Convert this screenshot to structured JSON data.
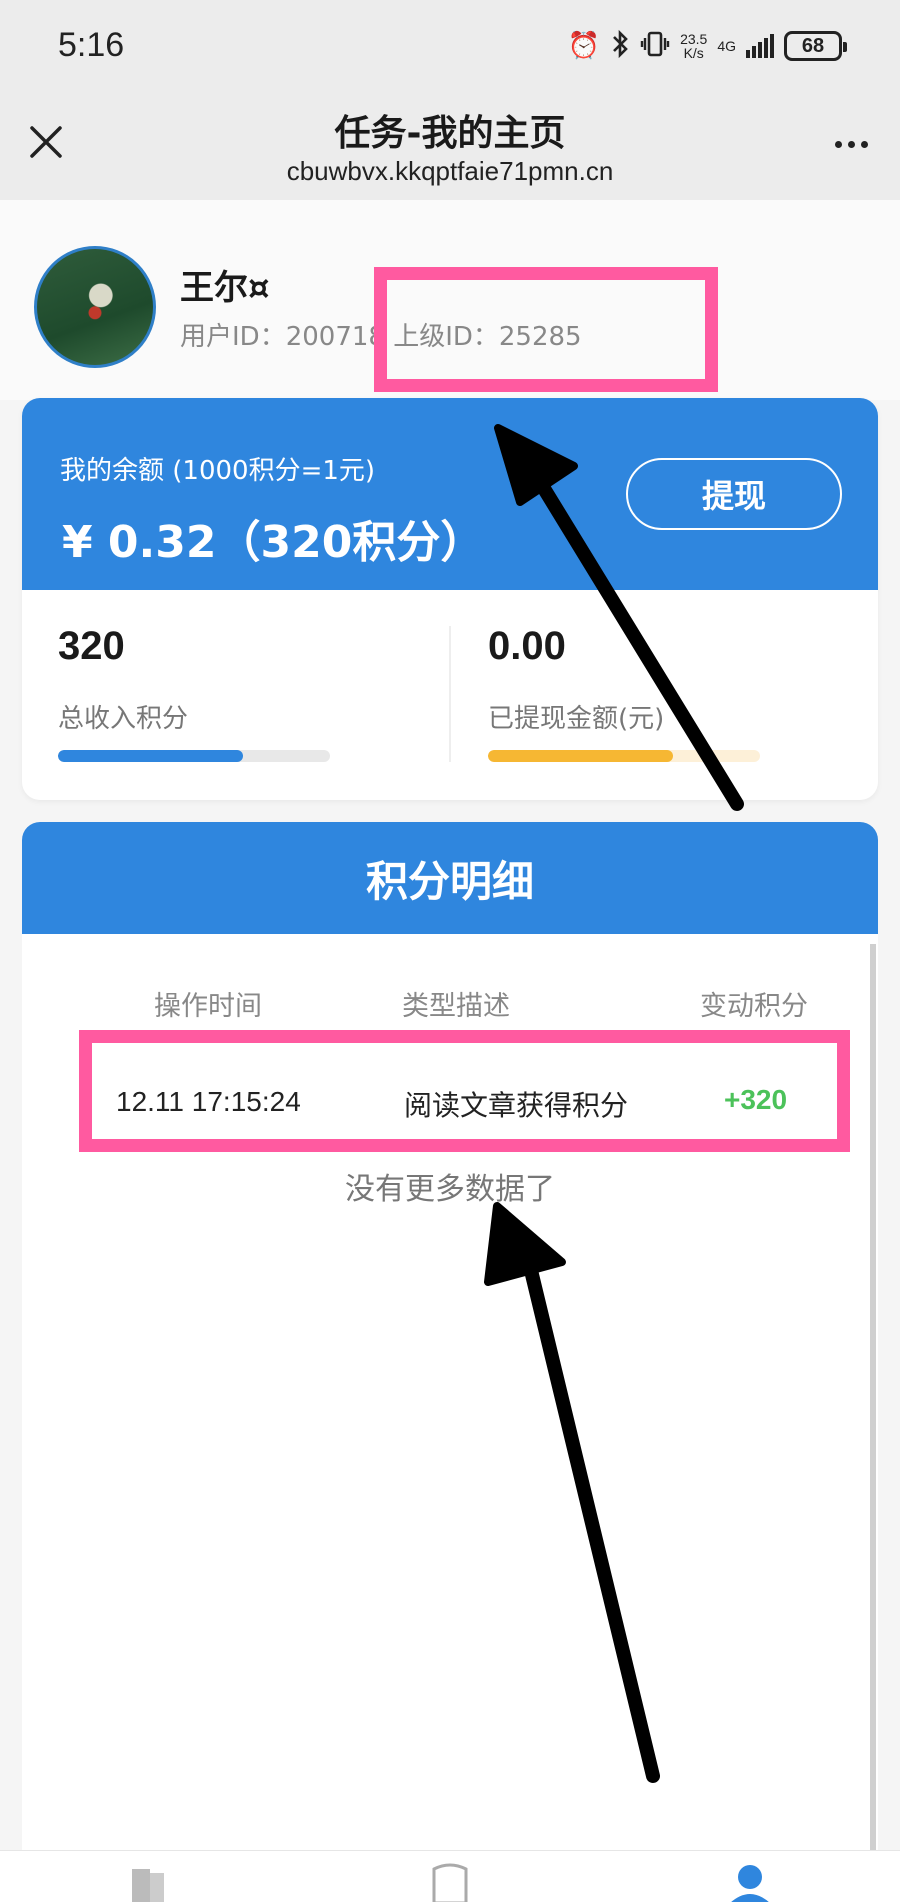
{
  "status_bar": {
    "time": "5:16",
    "net_speed_value": "23.5",
    "net_speed_unit": "K/s",
    "network_type": "4G",
    "battery": "68"
  },
  "title_bar": {
    "title": "任务-我的主页",
    "url": "cbuwbvx.kkqptfaie71pmn.cn"
  },
  "profile": {
    "username": "王尔¤",
    "user_ids": "用户ID：200718 上级ID：25285"
  },
  "balance": {
    "label": "我的余额 (1000积分=1元)",
    "amount": "¥ 0.32（320积分）",
    "withdraw_label": "提现",
    "total_points_value": "320",
    "total_points_label": "总收入积分",
    "total_points_progress": 0.68,
    "withdrawn_value": "0.00",
    "withdrawn_label": "已提现金额(元)",
    "withdrawn_progress": 0.68
  },
  "points_detail": {
    "title": "积分明细",
    "columns": [
      "操作时间",
      "类型描述",
      "变动积分"
    ],
    "rows": [
      {
        "time": "12.11 17:15:24",
        "type": "阅读文章获得积分",
        "points": "+320"
      }
    ],
    "no_more": "没有更多数据了"
  },
  "colors": {
    "primary": "#2f86de",
    "highlight": "#ff5aa0",
    "positive": "#4cc25a",
    "withdraw_bar": "#f6b733"
  },
  "icons": {
    "status": [
      "alarm-icon",
      "bluetooth-icon",
      "vibrate-icon",
      "signal-icon",
      "battery-icon"
    ],
    "nav": [
      "home-icon",
      "task-icon",
      "profile-icon"
    ]
  }
}
